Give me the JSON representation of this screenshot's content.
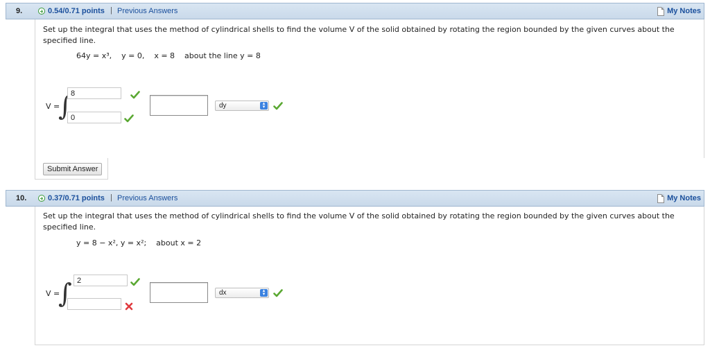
{
  "questions": [
    {
      "number": "9.",
      "points": "0.54/0.71 points",
      "separator": "|",
      "previous_answers": "Previous Answers",
      "my_notes": "My Notes",
      "prompt": "Set up the integral that uses the method of cylindrical shells to find the volume V of the solid obtained by rotating the region bounded by the given curves about the specified line.",
      "equation": "64y = x³,    y = 0,    x = 8    about the line y = 8",
      "v_label": "V =",
      "integral_symbol": "∫",
      "upper_limit": "8",
      "lower_limit": "0",
      "integrand": "",
      "differential": "dy",
      "upper_status": "correct",
      "lower_status": "correct",
      "differential_status": "correct",
      "submit_label": "Submit Answer"
    },
    {
      "number": "10.",
      "points": "0.37/0.71 points",
      "separator": "|",
      "previous_answers": "Previous Answers",
      "my_notes": "My Notes",
      "prompt": "Set up the integral that uses the method of cylindrical shells to find the volume V of the solid obtained by rotating the region bounded by the given curves about the specified line.",
      "equation": "y = 8 − x², y = x²;    about x = 2",
      "v_label": "V =",
      "integral_symbol": "∫",
      "upper_limit": "2",
      "lower_limit": "",
      "integrand": "",
      "differential": "dx",
      "upper_status": "correct",
      "lower_status": "incorrect",
      "differential_status": "correct"
    }
  ],
  "colors": {
    "header_bg": "#c9d9ea",
    "link": "#1a4f9c",
    "correct": "#5aa832",
    "incorrect": "#e0393e",
    "select_arrow": "#3b82e0"
  }
}
